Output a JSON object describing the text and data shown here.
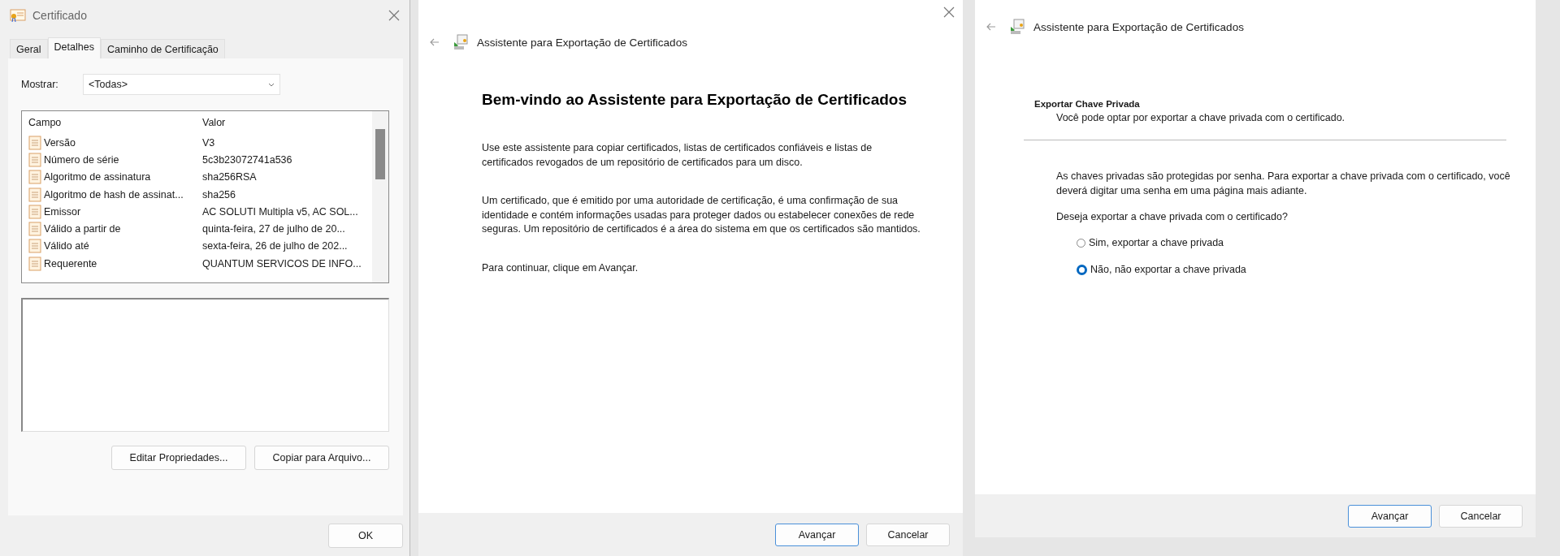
{
  "certificate_dialog": {
    "title": "Certificado",
    "tabs": [
      {
        "label": "Geral",
        "selected": false
      },
      {
        "label": "Detalhes",
        "selected": true
      },
      {
        "label": "Caminho de Certificação",
        "selected": false
      }
    ],
    "show_label": "Mostrar:",
    "show_value": "<Todas>",
    "columns": [
      "Campo",
      "Valor"
    ],
    "rows": [
      {
        "field": "Versão",
        "value": "V3"
      },
      {
        "field": "Número de série",
        "value": "5c3b23072741a536"
      },
      {
        "field": "Algoritmo de assinatura",
        "value": "sha256RSA"
      },
      {
        "field": "Algoritmo de hash de assinat...",
        "value": "sha256"
      },
      {
        "field": "Emissor",
        "value": "AC SOLUTI Multipla v5, AC SOL..."
      },
      {
        "field": "Válido a partir de",
        "value": "quinta-feira, 27 de julho de 20..."
      },
      {
        "field": "Válido até",
        "value": "sexta-feira, 26 de julho de 202..."
      },
      {
        "field": "Requerente",
        "value": "QUANTUM SERVICOS DE INFO..."
      }
    ],
    "buttons": [
      "Editar Propriedades...",
      "Copiar para Arquivo..."
    ],
    "ok": "OK"
  },
  "welcome_wizard": {
    "title": "Assistente para Exportação de Certificados",
    "heading": "Bem-vindo ao Assistente para Exportação de Certificados",
    "paragraphs": [
      "Use este assistente para copiar certificados, listas de certificados confiáveis e listas de certificados revogados de um repositório de certificados para um disco.",
      "Um certificado, que é emitido por uma autoridade de certificação, é uma confirmação de sua identidade e contém informações usadas para proteger dados ou estabelecer conexões de rede seguras. Um repositório de certificados é a área do sistema em que os certificados são mantidos.",
      "Para continuar, clique em Avançar."
    ],
    "buttons": [
      {
        "label": "Avançar",
        "default": true
      },
      {
        "label": "Cancelar",
        "default": false
      }
    ]
  },
  "export_wizard": {
    "title": "Assistente para Exportação de Certificados",
    "section_title": "Exportar Chave Privada",
    "section_subtitle": "Você pode optar por exportar a chave privada com o certificado.",
    "paragraph": "As chaves privadas são protegidas por senha. Para exportar a chave privada com o certificado, você deverá digitar uma senha em uma página mais adiante.",
    "question": "Deseja exportar a chave privada com o certificado?",
    "options": [
      {
        "label": "Sim, exportar a chave privada",
        "selected": false
      },
      {
        "label": "Não, não exportar a chave privada",
        "selected": true
      }
    ],
    "buttons": [
      {
        "label": "Avançar",
        "default": true
      },
      {
        "label": "Cancelar",
        "default": false
      }
    ]
  }
}
